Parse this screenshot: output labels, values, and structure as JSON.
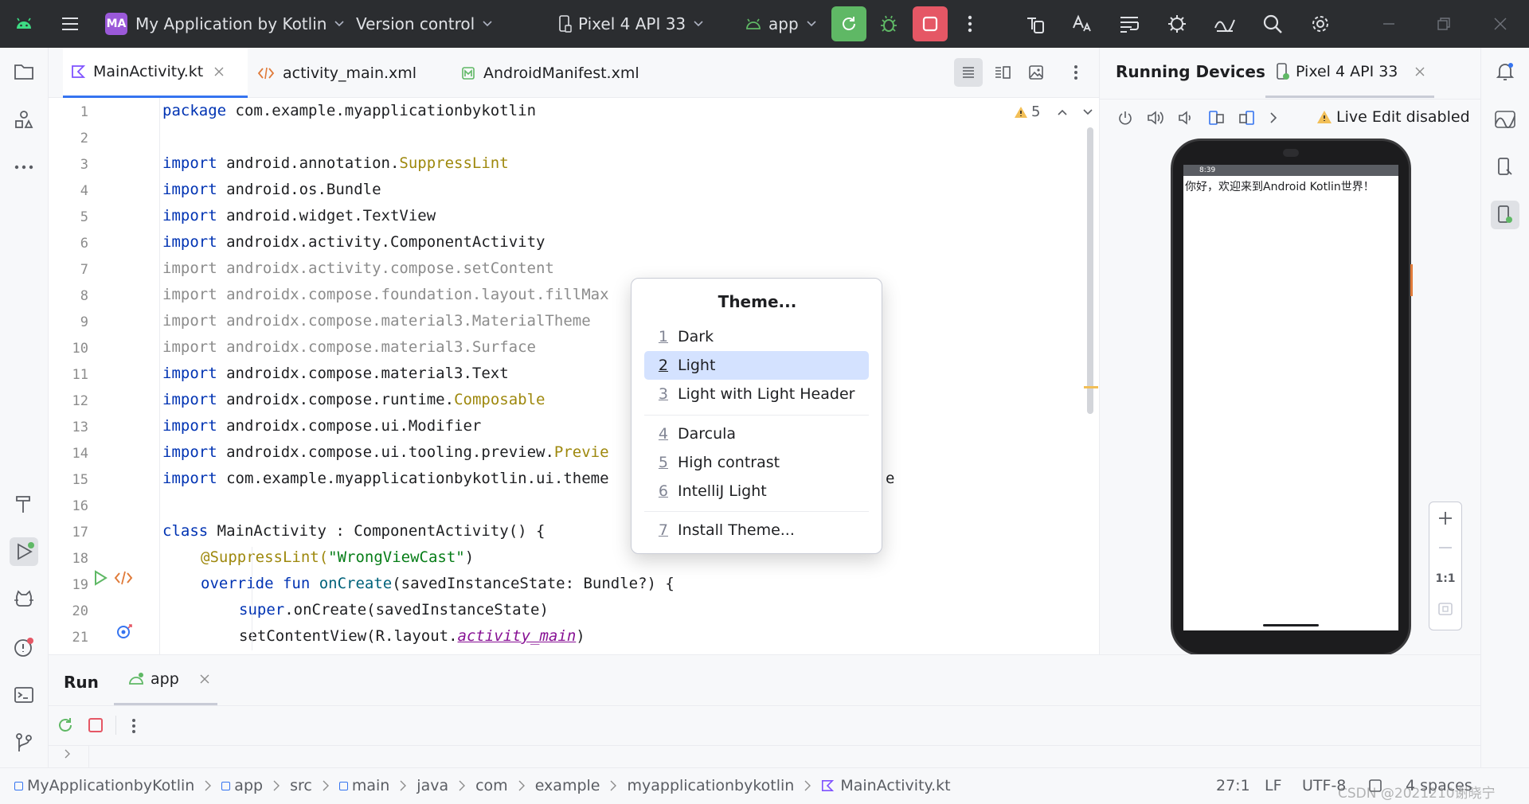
{
  "titlebar": {
    "project_badge": "MA",
    "project_name": "My Application by Kotlin",
    "version_control": "Version control",
    "device": "Pixel 4 API 33",
    "run_config": "app"
  },
  "editor": {
    "tabs": [
      {
        "label": "MainActivity.kt"
      },
      {
        "label": "activity_main.xml"
      },
      {
        "label": "AndroidManifest.xml"
      }
    ],
    "warning_count": "5",
    "line_numbers": [
      "1",
      "2",
      "3",
      "4",
      "5",
      "6",
      "7",
      "8",
      "9",
      "10",
      "11",
      "12",
      "13",
      "14",
      "15",
      "16",
      "17",
      "18",
      "19",
      "20",
      "21"
    ],
    "code_lines": [
      {
        "a": "package",
        "b": " com.example.myapplicationbykotlin",
        "c": ""
      },
      {
        "a": "",
        "b": "",
        "c": ""
      },
      {
        "a": "import",
        "b": " android.annotation.",
        "c": "SuppressLint"
      },
      {
        "a": "import",
        "b": " android.os.Bundle",
        "c": ""
      },
      {
        "a": "import",
        "b": " android.widget.TextView",
        "c": ""
      },
      {
        "a": "import",
        "b": " androidx.activity.ComponentActivity",
        "c": ""
      },
      {
        "a": "import androidx.activity.compose.setContent",
        "b": "",
        "c": ""
      },
      {
        "a": "import androidx.compose.foundation.layout.fillMax",
        "b": "",
        "c": ""
      },
      {
        "a": "import androidx.compose.material3.MaterialTheme",
        "b": "",
        "c": ""
      },
      {
        "a": "import androidx.compose.material3.Surface",
        "b": "",
        "c": ""
      },
      {
        "a": "import",
        "b": " androidx.compose.material3.Text",
        "c": ""
      },
      {
        "a": "import",
        "b": " androidx.compose.runtime.",
        "c": "Composable"
      },
      {
        "a": "import",
        "b": " androidx.compose.ui.Modifier",
        "c": ""
      },
      {
        "a": "import",
        "b": " androidx.compose.ui.tooling.preview.",
        "c": "Previe"
      },
      {
        "a": "import",
        "b": " com.example.myapplicationbykotlin.ui.theme",
        "c": ""
      },
      {
        "a": "",
        "b": "",
        "c": ""
      }
    ],
    "line15_tail": "e",
    "line17": {
      "kw": "class",
      "rest": " MainActivity : ComponentActivity() {"
    },
    "line18": {
      "ann": "@SuppressLint(",
      "str": "\"WrongViewCast\"",
      "close": ")"
    },
    "line19": {
      "kw": "override fun",
      "fn": " onCreate",
      "rest": "(savedInstanceState: Bundle?) {"
    },
    "line20": {
      "kw": "super",
      "rest": ".onCreate(savedInstanceState)"
    },
    "line21": {
      "pre": "setContentView(R.layout.",
      "ital": "activity_main",
      "post": ")"
    }
  },
  "theme_popup": {
    "title": "Theme...",
    "group1": [
      {
        "num": "1",
        "label": "Dark"
      },
      {
        "num": "2",
        "label": "Light",
        "selected": true
      },
      {
        "num": "3",
        "label": "Light with Light Header"
      }
    ],
    "group2": [
      {
        "num": "4",
        "label": "Darcula"
      },
      {
        "num": "5",
        "label": "High contrast"
      },
      {
        "num": "6",
        "label": "IntelliJ Light"
      }
    ],
    "group3": [
      {
        "num": "7",
        "label": "Install Theme..."
      }
    ]
  },
  "devices_panel": {
    "title": "Running Devices",
    "tab": "Pixel 4 API 33",
    "live_edit": "Live Edit disabled",
    "phone_time": "8:39",
    "phone_text": "你好，欢迎来到Android Kotlin世界！",
    "zoom_reset": "1:1"
  },
  "run_panel": {
    "title": "Run",
    "tab": "app"
  },
  "statusbar": {
    "breadcrumbs": [
      "MyApplicationbyKotlin",
      "app",
      "src",
      "main",
      "java",
      "com",
      "example",
      "myapplicationbykotlin",
      "MainActivity.kt"
    ],
    "position": "27:1",
    "line_sep": "LF",
    "encoding": "UTF-8",
    "indent": "4 spaces",
    "watermark": "CSDN @2021210谢晓宁"
  },
  "colors": {
    "accent": "#3574f0",
    "selection": "#d4e2ff",
    "titlebar": "#2b2d30",
    "run_green": "#5fb865",
    "stop_red": "#e55765"
  }
}
